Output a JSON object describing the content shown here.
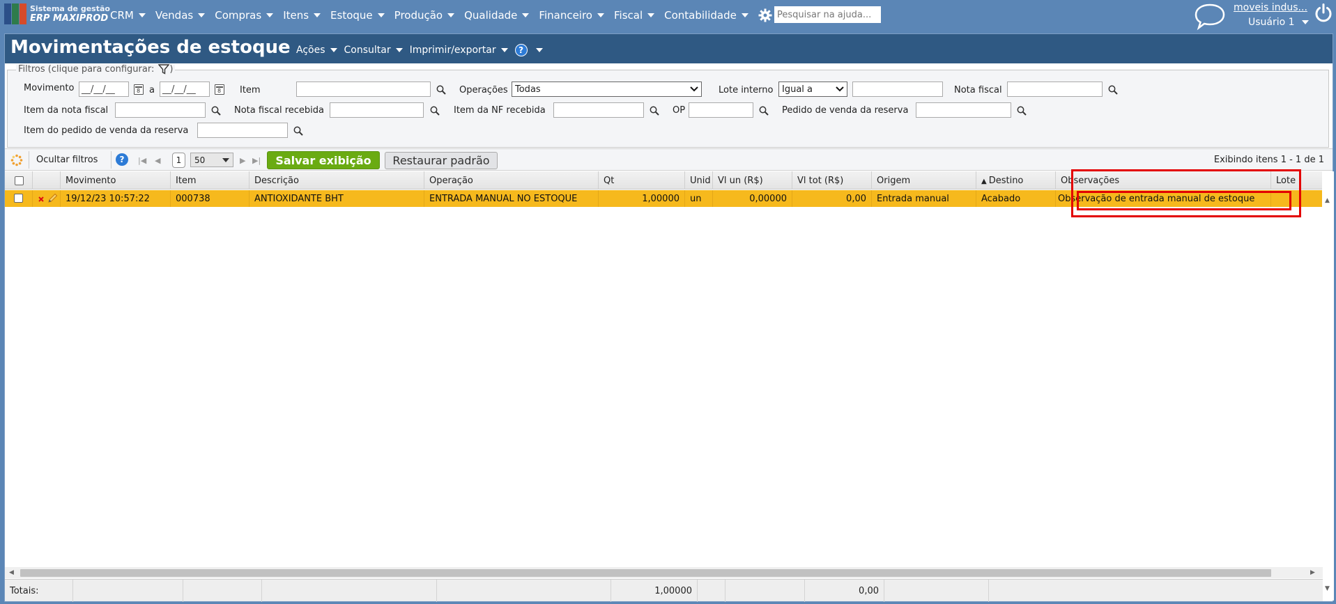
{
  "app": {
    "logo_line1": "Sistema de gestão",
    "logo_line2": "ERP MAXIPROD",
    "logo_colors": [
      "#2b4f88",
      "#2e7b4b",
      "#d64b2a"
    ]
  },
  "top_menu": [
    "CRM",
    "Vendas",
    "Compras",
    "Itens",
    "Estoque",
    "Produção",
    "Qualidade",
    "Financeiro",
    "Fiscal",
    "Contabilidade"
  ],
  "search_help": {
    "placeholder": "Pesquisar na ajuda..."
  },
  "user": {
    "company": "moveis indus...",
    "name": "Usuário 1"
  },
  "page": {
    "title": "Movimentações de estoque",
    "menu": [
      "Ações",
      "Consultar",
      "Imprimir/exportar"
    ],
    "help_label": "?"
  },
  "filters": {
    "legend": "Filtros (clique para configurar:",
    "legend_end": ")",
    "movimento_label": "Movimento",
    "date_mask": "__/__/__",
    "date_sep": "a",
    "cal_glyph": "8",
    "item_label": "Item",
    "operacoes_label": "Operações",
    "operacoes_value": "Todas",
    "lote_label": "Lote interno",
    "lote_op": "Igual a",
    "nota_fiscal_label": "Nota fiscal",
    "item_nota_label": "Item da nota fiscal",
    "nf_recebida_label": "Nota fiscal recebida",
    "item_nf_recebida_label": "Item da NF recebida",
    "op_label": "OP",
    "pedido_label": "Pedido de venda da reserva",
    "item_pedido_label": "Item do pedido de venda da reserva"
  },
  "toolbar": {
    "hide_filters": "Ocultar filtros",
    "page": "1",
    "page_size": "50",
    "save": "Salvar exibição",
    "restore": "Restaurar padrão",
    "showing": "Exibindo itens 1 - 1 de 1",
    "help_label": "?"
  },
  "grid": {
    "columns": [
      "Movimento",
      "Item",
      "Descrição",
      "Operação",
      "Qt",
      "Unid",
      "Vl un (R$)",
      "Vl tot (R$)",
      "Origem",
      "Destino",
      "Observações",
      "Lote i"
    ],
    "sort_indicator": "▲",
    "row": {
      "movimento": "19/12/23 10:57:22",
      "item": "000738",
      "descricao": "ANTIOXIDANTE BHT",
      "operacao": "ENTRADA MANUAL NO ESTOQUE",
      "qt": "1,00000",
      "unid": "un",
      "vl_un": "0,00000",
      "vl_tot": "0,00",
      "origem": "Entrada manual",
      "destino": "Acabado",
      "observacoes": "Observação de entrada manual de estoque"
    },
    "row_color": "#f6b91d"
  },
  "totals": {
    "label": "Totais:",
    "qt": "1,00000",
    "vl_tot": "0,00"
  },
  "highlight_color": "#e30000",
  "icons": [
    "gear-icon",
    "help-icon",
    "chat-icon",
    "power-icon",
    "filter-icon",
    "search-icon",
    "calendar-icon",
    "refresh-icon",
    "delete-icon",
    "edit-icon"
  ]
}
